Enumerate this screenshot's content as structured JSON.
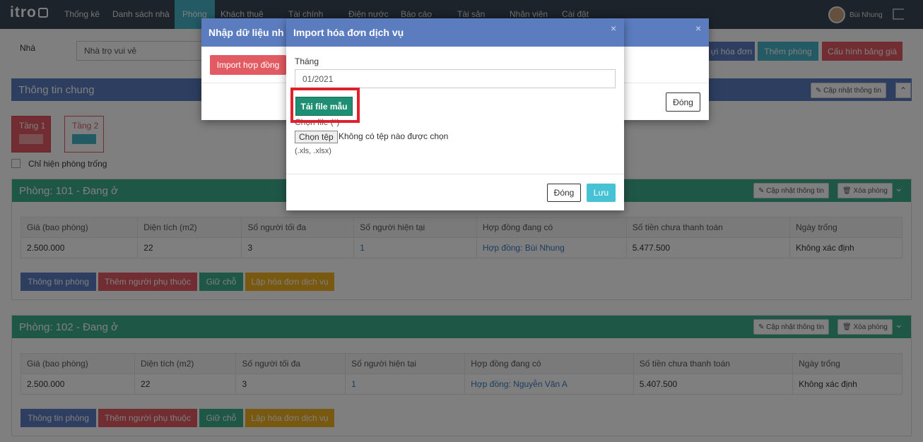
{
  "nav": {
    "logo": "itro",
    "items": [
      "Thống kê",
      "Danh sách nhà",
      "Phòng",
      "Khách thuê",
      "Tài chính",
      "Điện nước",
      "Báo cáo",
      "Tài sản",
      "Nhân viên",
      "Cài đặt"
    ],
    "user": "Bùi Nhung"
  },
  "filter": {
    "label": "Nhà",
    "value": "Nhà trọ vui vẻ"
  },
  "top_buttons": {
    "invoice": "ựi hóa đơn",
    "add_room": "Thêm phòng",
    "price_config": "Cấu hình bảng giá"
  },
  "general": {
    "title": "Thông tin chung",
    "update": "Cập nhật thông tin"
  },
  "floors": [
    {
      "label": "Tầng 1"
    },
    {
      "label": "Tầng 2"
    }
  ],
  "empty_only": "Chỉ hiện phòng trống",
  "rooms": [
    {
      "title": "Phòng: 101 - Đang ở",
      "update": "Cập nhật thông tin",
      "delete": "Xóa phòng",
      "headers": [
        "Giá (bao phòng)",
        "Diện tích (m2)",
        "Số người tối đa",
        "Số người hiện tại",
        "Hợp đồng đang có",
        "Số tiền chưa thanh toán",
        "Ngày trống"
      ],
      "values": [
        "2.500.000",
        "22",
        "3",
        "1",
        "Hợp đồng: Bùi Nhung",
        "5.477.500",
        "Không xác định"
      ],
      "actions": [
        "Thông tin phòng",
        "Thêm người phụ thuộc",
        "Giữ chỗ",
        "Lập hóa đơn dịch vụ"
      ]
    },
    {
      "title": "Phòng: 102 - Đang ở",
      "update": "Cập nhật thông tin",
      "delete": "Xóa phòng",
      "headers": [
        "Giá (bao phòng)",
        "Diện tích (m2)",
        "Số người tối đa",
        "Số người hiện tại",
        "Hợp đồng đang có",
        "Số tiền chưa thanh toán",
        "Ngày trống"
      ],
      "values": [
        "2.500.000",
        "22",
        "3",
        "1",
        "Hợp đồng: Nguyễn Văn A",
        "5.407.500",
        "Không xác định"
      ],
      "actions": [
        "Thông tin phòng",
        "Thêm người phụ thuộc",
        "Giữ chỗ",
        "Lập hóa đơn dịch vụ"
      ]
    }
  ],
  "modal_back": {
    "title": "Nhập dữ liệu nh",
    "import_contract": "Import hợp đồng",
    "close": "Đóng"
  },
  "modal_front": {
    "title": "Import hóa đơn dịch vụ",
    "month_label": "Tháng",
    "month_value": "01/2021",
    "download_template": "Tải file mẫu",
    "choose_file_label": "Chọn file (*)",
    "choose_button": "Chọn tệp",
    "no_file": "Không có tệp nào được chọn",
    "formats": "(.xls, .xlsx)",
    "close": "Đóng",
    "save": "Lưu"
  }
}
